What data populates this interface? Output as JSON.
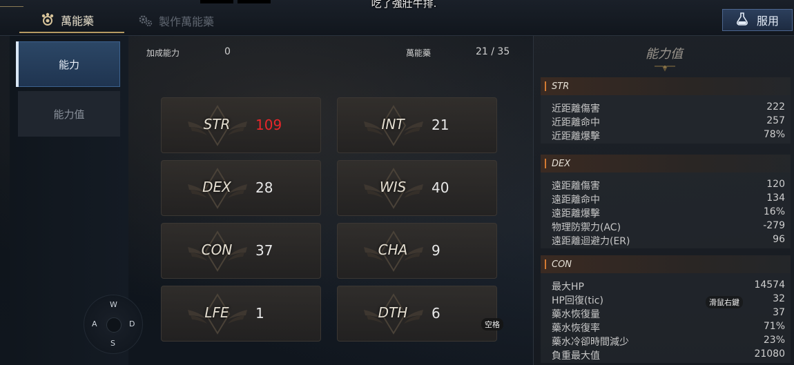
{
  "top_message": "吃了強壯牛排.",
  "tabs": [
    {
      "label": "萬能藥",
      "icon": "elixir-icon",
      "active": true
    },
    {
      "label": "製作萬能藥",
      "icon": "craft-gear-icon",
      "active": false
    }
  ],
  "use_button": {
    "label": "服用",
    "icon": "potion-flask-icon"
  },
  "nav": [
    {
      "label": "能力",
      "active": true
    },
    {
      "label": "能力值",
      "active": false
    }
  ],
  "header": {
    "bonus_label": "加成能力",
    "bonus_value": "0",
    "elixir_label": "萬能藥",
    "elixir_value": "21 / 35"
  },
  "stats": [
    {
      "name": "STR",
      "value": "109",
      "highlight": true
    },
    {
      "name": "INT",
      "value": "21"
    },
    {
      "name": "DEX",
      "value": "28"
    },
    {
      "name": "WIS",
      "value": "40"
    },
    {
      "name": "CON",
      "value": "37"
    },
    {
      "name": "CHA",
      "value": "9"
    },
    {
      "name": "LFE",
      "value": "1"
    },
    {
      "name": "DTH",
      "value": "6"
    }
  ],
  "compass": {
    "n": "W",
    "w": "A",
    "e": "D",
    "s": "S"
  },
  "hints": {
    "space": "空格",
    "right_click": "滑鼠右鍵"
  },
  "panel": {
    "title": "能力值",
    "sections": [
      {
        "name": "STR",
        "rows": [
          {
            "label": "近距離傷害",
            "value": "222"
          },
          {
            "label": "近距離命中",
            "value": "257"
          },
          {
            "label": "近距離爆擊",
            "value": "78%"
          }
        ]
      },
      {
        "name": "DEX",
        "rows": [
          {
            "label": "遠距離傷害",
            "value": "120"
          },
          {
            "label": "遠距離命中",
            "value": "134"
          },
          {
            "label": "遠距離爆擊",
            "value": "16%"
          },
          {
            "label": "物理防禦力(AC)",
            "value": "-279"
          },
          {
            "label": "遠距離迴避力(ER)",
            "value": "96"
          }
        ]
      },
      {
        "name": "CON",
        "rows": [
          {
            "label": "最大HP",
            "value": "14574"
          },
          {
            "label": "HP回復(tic)",
            "value": "32"
          },
          {
            "label": "藥水恢復量",
            "value": "37"
          },
          {
            "label": "藥水恢復率",
            "value": "71%"
          },
          {
            "label": "藥水冷卻時間減少",
            "value": "23%"
          },
          {
            "label": "負重最大值",
            "value": "21080"
          }
        ]
      }
    ]
  },
  "colors": {
    "accent_gold": "#b59a62",
    "stat_highlight": "#e8262a",
    "section_bar": "#d47a32",
    "button_blue": "#2c3f5c"
  }
}
